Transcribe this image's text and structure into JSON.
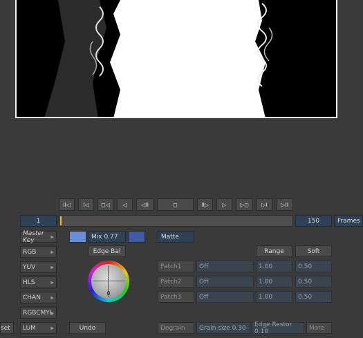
{
  "transport": {
    "buttons": [
      "II◁",
      "I◁",
      "◻◁",
      "◁",
      "◁II",
      "◻",
      "II▷",
      "▷",
      "▷◻",
      "▷I",
      "▷II"
    ],
    "start_frame": "1",
    "end_frame": "150",
    "units_label": "Frames"
  },
  "keyer": {
    "mix_label": "Mix 0.77",
    "edge_bal_label": "Edge Bal",
    "matte_label": "Matte",
    "range_label": "Range",
    "soft_label": "Soft",
    "wheel_value": "0",
    "undo_label": "Undo",
    "swatch_left_color": "#6b8ed8",
    "swatch_right_color": "#3f5ba8"
  },
  "sidebar": {
    "items": [
      "Master Key",
      "RGB",
      "YUV",
      "HLS",
      "CHAN",
      "RGBCMYL",
      "LUM"
    ]
  },
  "patches": [
    {
      "label": "Patch1",
      "state": "Off",
      "range": "1.00",
      "soft": "0.50"
    },
    {
      "label": "Patch2",
      "state": "Off",
      "range": "1.00",
      "soft": "0.50"
    },
    {
      "label": "Patch3",
      "state": "Off",
      "range": "1.00",
      "soft": "0.50"
    }
  ],
  "bottom": {
    "reset_label": "set",
    "degrain_label": "Degrain",
    "grain_size_label": "Grain size 0.30",
    "edge_restor_label": "Edge Restor 0.10",
    "more_label": "More"
  }
}
